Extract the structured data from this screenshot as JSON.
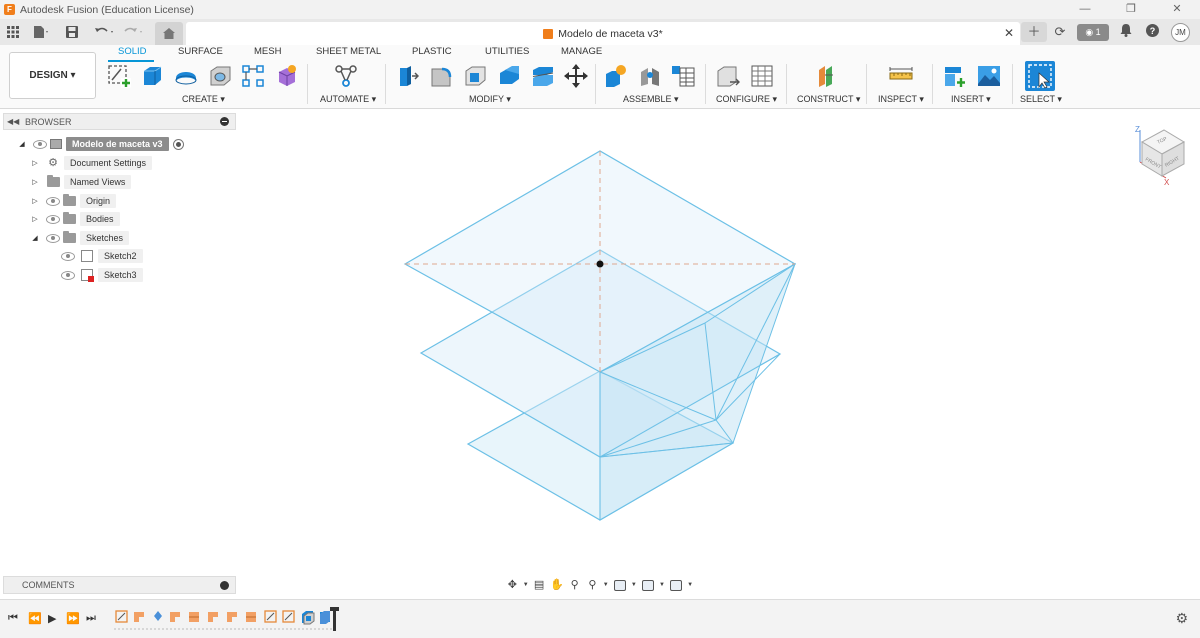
{
  "window": {
    "title": "Autodesk Fusion (Education License)",
    "minimize": "—",
    "maximize": "❐",
    "close": "✕"
  },
  "quick_access": {
    "document_title": "Modelo de maceta v3*",
    "job_count": "1",
    "user_initials": "JM"
  },
  "workspace": {
    "label": "DESIGN ▾"
  },
  "tabs": [
    "SOLID",
    "SURFACE",
    "MESH",
    "SHEET METAL",
    "PLASTIC",
    "UTILITIES",
    "MANAGE"
  ],
  "active_tab": "SOLID",
  "groups": {
    "create": "CREATE ▾",
    "automate": "AUTOMATE ▾",
    "modify": "MODIFY ▾",
    "assemble": "ASSEMBLE ▾",
    "configure": "CONFIGURE ▾",
    "construct": "CONSTRUCT ▾",
    "inspect": "INSPECT ▾",
    "insert": "INSERT ▾",
    "select": "SELECT ▾"
  },
  "browser": {
    "title": "BROWSER",
    "root": "Modelo de maceta v3",
    "items": {
      "document_settings": "Document Settings",
      "named_views": "Named Views",
      "origin": "Origin",
      "bodies": "Bodies",
      "sketches": "Sketches",
      "sketch2": "Sketch2",
      "sketch3": "Sketch3"
    }
  },
  "comments": {
    "title": "COMMENTS"
  },
  "viewcube": {
    "top_label": "TOP",
    "front_label": "FRONT",
    "right_label": "RIGHT",
    "axis_z": "Z",
    "axis_x": "X"
  },
  "colors": {
    "accent": "#0696d7",
    "model_edge": "#6cc0e6",
    "model_fill": "#d6ecf8",
    "timeline_sketch": "#f2a064",
    "timeline_body": "#4a90d9"
  },
  "icons": {
    "grid": "grid-icon",
    "file": "file-icon",
    "save": "save-icon",
    "undo": "undo-icon",
    "redo": "redo-icon",
    "home": "home-icon",
    "add_tab": "plus-icon",
    "refresh": "refresh-icon",
    "notifications": "bell-icon",
    "help": "help-icon",
    "settings": "gear-icon"
  }
}
